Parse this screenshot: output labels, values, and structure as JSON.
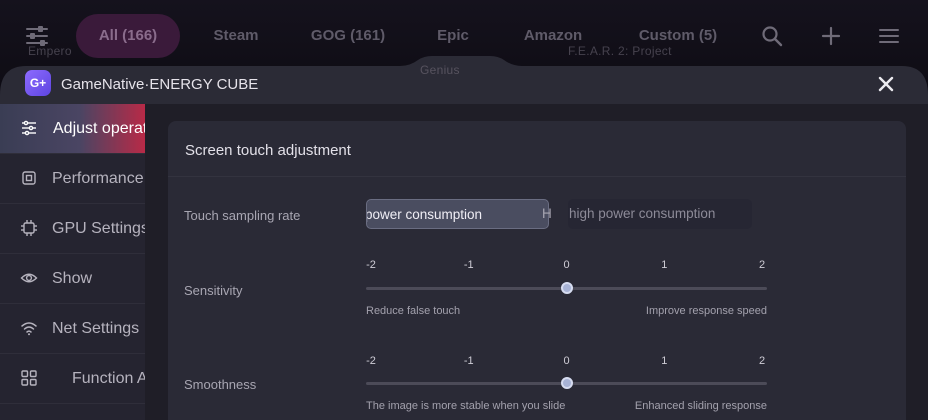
{
  "background": {
    "tabs": [
      {
        "label": "All (166)",
        "active": true
      },
      {
        "label": "Steam",
        "active": false
      },
      {
        "label": "GOG (161)",
        "active": false
      },
      {
        "label": "Epic",
        "active": false
      },
      {
        "label": "Amazon",
        "active": false
      },
      {
        "label": "Custom (5)",
        "active": false
      }
    ],
    "ghost_titles": [
      "Empero",
      "F.E.A.R. 2: Project",
      "Genius"
    ],
    "icons": [
      "filter-icon",
      "search-icon",
      "plus-icon",
      "menu-icon"
    ]
  },
  "dialog": {
    "logo_text": "G+",
    "title": "GameNative·ENERGY CUBE",
    "close_label": "✕"
  },
  "sidebar": {
    "items": [
      {
        "label": "Adjust operation",
        "icon": "sliders-icon",
        "active": true
      },
      {
        "label": "Performance",
        "icon": "chip-icon",
        "active": false
      },
      {
        "label": "GPU Settings",
        "icon": "gpu-icon",
        "active": false
      },
      {
        "label": "Show",
        "icon": "eye-icon",
        "active": false
      },
      {
        "label": "Net Settings",
        "icon": "wifi-icon",
        "active": false
      },
      {
        "label": "Function A",
        "icon": "grid-icon",
        "active": false
      }
    ]
  },
  "panel": {
    "title": "Screen touch adjustment",
    "touch_sampling": {
      "label": "Touch sampling rate",
      "options": [
        {
          "label": "Low power consumption",
          "visible_text": "power consumption",
          "selected": true
        },
        {
          "label": "High power consumption",
          "visible_text": "high power consumption",
          "selected": false
        }
      ],
      "peek_text": "H"
    },
    "sensitivity": {
      "label": "Sensitivity",
      "ticks": [
        "-2",
        "-1",
        "0",
        "1",
        "2"
      ],
      "min": -2,
      "max": 2,
      "value": 0,
      "hint_left": "Reduce false touch",
      "hint_right": "Improve response speed"
    },
    "smoothness": {
      "label": "Smoothness",
      "ticks": [
        "-2",
        "-1",
        "0",
        "1",
        "2"
      ],
      "min": -2,
      "max": 2,
      "value": 0,
      "hint_left": "The image is more stable when you slide",
      "hint_right": "Enhanced sliding response"
    }
  },
  "colors": {
    "accent_gradient_end": "#b82a47",
    "slider_thumb": "#a8b3d6",
    "active_tab_bg": "#3a1a3a"
  }
}
